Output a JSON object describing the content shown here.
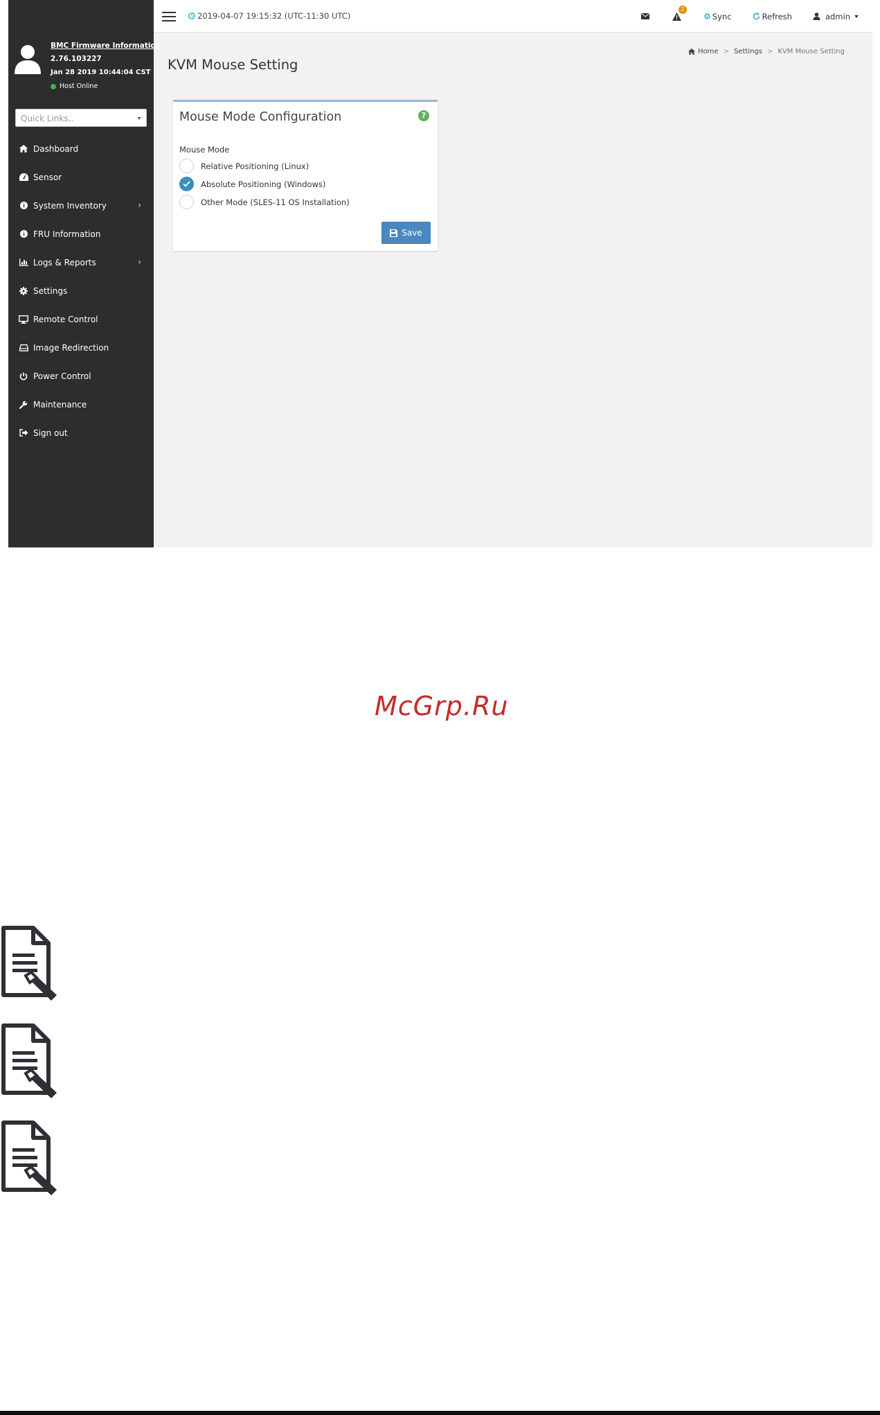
{
  "topbar": {
    "datetime": "2019-04-07 19:15:32 (UTC-11:30 UTC)",
    "alert_count": "2",
    "sync_label": "Sync",
    "refresh_label": "Refresh",
    "user_label": "admin"
  },
  "sidebar": {
    "firmware_link": "BMC Firmware Information",
    "firmware_version": "2.76.103227",
    "firmware_date": "Jan 28 2019 10:44:04 CST",
    "host_status": "Host Online",
    "quick_links_placeholder": "Quick Links..",
    "items": [
      {
        "label": "Dashboard",
        "icon": "home-icon"
      },
      {
        "label": "Sensor",
        "icon": "gauge-icon"
      },
      {
        "label": "System Inventory",
        "icon": "info-icon",
        "has_submenu": true
      },
      {
        "label": "FRU Information",
        "icon": "info-icon"
      },
      {
        "label": "Logs & Reports",
        "icon": "bar-chart-icon",
        "has_submenu": true
      },
      {
        "label": "Settings",
        "icon": "gear-icon"
      },
      {
        "label": "Remote Control",
        "icon": "monitor-icon"
      },
      {
        "label": "Image Redirection",
        "icon": "disk-icon"
      },
      {
        "label": "Power Control",
        "icon": "power-icon"
      },
      {
        "label": "Maintenance",
        "icon": "wrench-icon"
      },
      {
        "label": "Sign out",
        "icon": "sign-out-icon"
      }
    ]
  },
  "page": {
    "title": "KVM Mouse Setting",
    "breadcrumb": [
      "Home",
      "Settings",
      "KVM Mouse Setting"
    ]
  },
  "card": {
    "title": "Mouse Mode Configuration",
    "help": "?",
    "field_label": "Mouse Mode",
    "options": [
      {
        "label": "Relative Positioning (Linux)",
        "checked": false
      },
      {
        "label": "Absolute Positioning (Windows)",
        "checked": true
      },
      {
        "label": "Other Mode (SLES-11 OS Installation)",
        "checked": false
      }
    ],
    "save_label": "Save"
  },
  "watermark": "McGrp.Ru",
  "colors": {
    "sidebar_bg": "#2b2d2f",
    "accent": "#3c8dbc",
    "save_button": "#4a89bf",
    "help_icon": "#5fb35f",
    "badge": "#e08e0b",
    "watermark": "#c22c2c"
  }
}
